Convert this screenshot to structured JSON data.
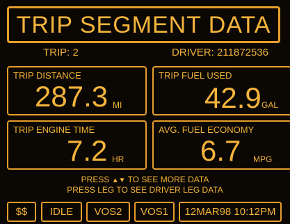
{
  "header": {
    "title": "TRIP SEGMENT DATA"
  },
  "info": {
    "trip": "TRIP: 2",
    "driver": "DRIVER: 211872536"
  },
  "panels": [
    {
      "label": "TRIP DISTANCE",
      "value": "287.3",
      "unit": "MI"
    },
    {
      "label": "TRIP FUEL USED",
      "value": "42.9",
      "unit": "GAL"
    },
    {
      "label": "TRIP ENGINE TIME",
      "value": "7.2",
      "unit": "HR"
    },
    {
      "label": "AVG. FUEL ECONOMY",
      "value": "6.7",
      "unit": "MPG"
    }
  ],
  "prompts": {
    "line1_prefix": "PRESS",
    "arrow_up": "▲",
    "arrow_down": "▼",
    "line1_suffix": "TO SEE MORE DATA",
    "line2": "PRESS LEG TO SEE DRIVER LEG DATA"
  },
  "softkeys": [
    "$$",
    "IDLE",
    "VOS2",
    "VOS1",
    "12MAR98 10:12PM"
  ],
  "colors": {
    "foreground": "#f2b23a",
    "border": "#e79d2c",
    "background": "#0b0803"
  }
}
